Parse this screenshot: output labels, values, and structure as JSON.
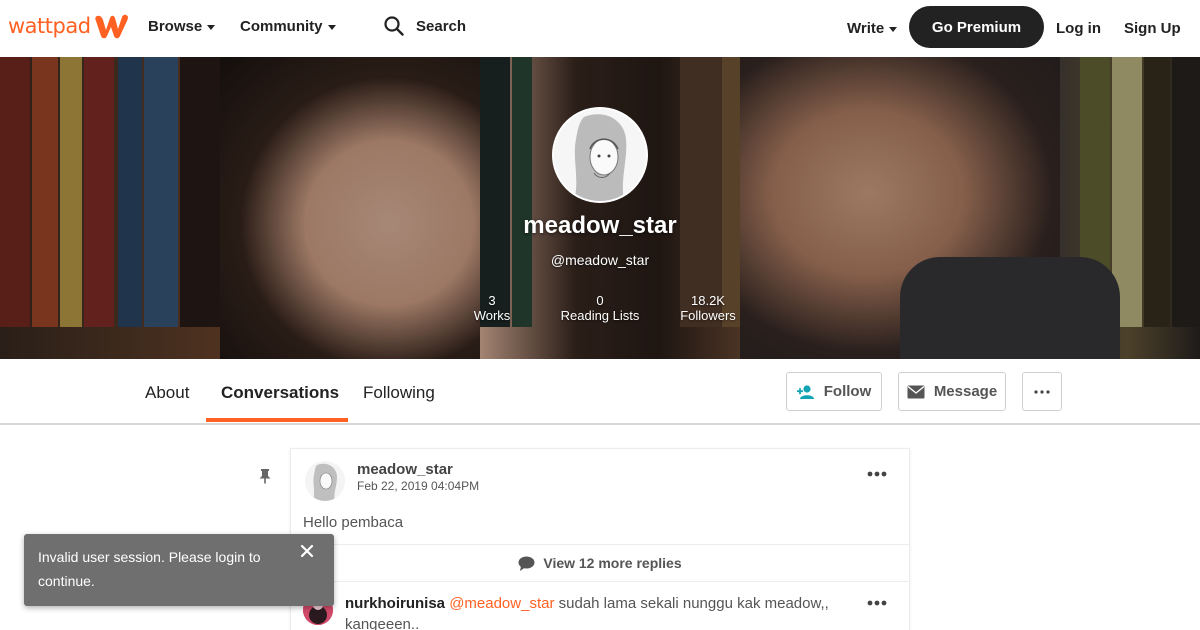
{
  "nav": {
    "logo_text": "wattpad",
    "browse": "Browse",
    "community": "Community",
    "search_label": "Search",
    "write": "Write",
    "premium": "Go Premium",
    "login": "Log in",
    "signup": "Sign Up"
  },
  "profile": {
    "username": "meadow_star",
    "handle": "@meadow_star",
    "stats": [
      {
        "value": "3",
        "label": "Works"
      },
      {
        "value": "0",
        "label": "Reading Lists"
      },
      {
        "value": "18.2K",
        "label": "Followers"
      }
    ]
  },
  "tabs": {
    "about": "About",
    "conversations": "Conversations",
    "following": "Following",
    "follow": "Follow",
    "message": "Message"
  },
  "post": {
    "author": "meadow_star",
    "date": "Feb 22, 2019 04:04PM",
    "body": "Hello pembaca",
    "replies": "View 12 more replies",
    "reply": {
      "author": "nurkhoirunisa",
      "mention": "@meadow_star",
      "text": "sudah lama sekali nunggu kak meadow,, kangeeen.."
    }
  },
  "toast": {
    "message": "Invalid user session. Please login to continue."
  },
  "colors": {
    "brand": "#ff6122",
    "dark_button": "#222222",
    "toast_bg": "#6f6f6f",
    "follow_icon": "#12a3b4"
  }
}
